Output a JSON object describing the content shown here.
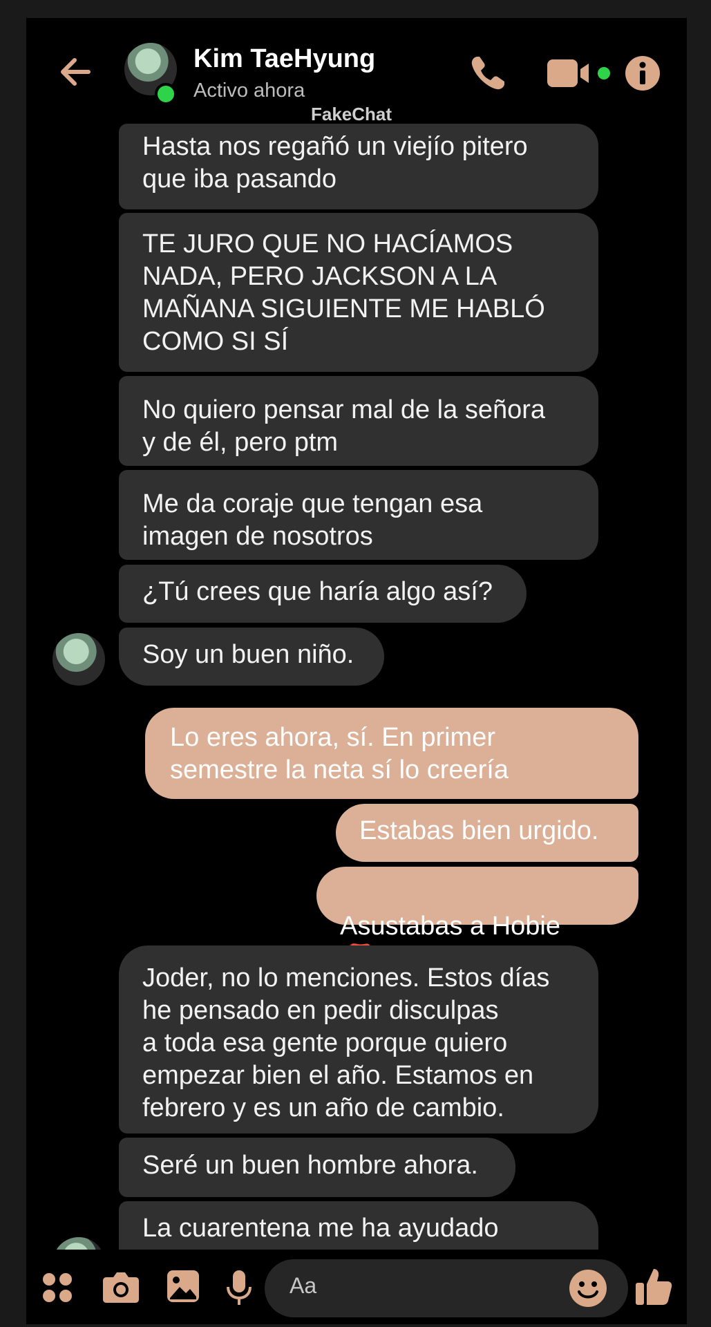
{
  "header": {
    "contact_name": "Kim TaeHyung",
    "status": "Activo ahora",
    "watermark": "FakeChat",
    "accent_color": "#d9a98a"
  },
  "messages": [
    {
      "from": "contact",
      "text": "Hasta nos regañó un viejío pitero\nque iba pasando"
    },
    {
      "from": "contact",
      "text": "TE JURO QUE NO HACÍAMOS\nNADA, PERO JACKSON A LA\nMAÑANA SIGUIENTE ME HABLÓ\nCOMO SI SÍ"
    },
    {
      "from": "contact",
      "text": "No quiero pensar mal de la señora\ny de él, pero ptm"
    },
    {
      "from": "contact",
      "text": "Me da coraje que tengan esa\nimagen de nosotros"
    },
    {
      "from": "contact",
      "text": "¿Tú crees que haría algo así?"
    },
    {
      "from": "contact",
      "text": "Soy un buen niño."
    },
    {
      "from": "me",
      "text": "Lo eres ahora, sí. En primer\nsemestre la neta sí lo creería"
    },
    {
      "from": "me",
      "text": "Estabas bien urgido."
    },
    {
      "from": "me",
      "text": "Asustabas a Hobie"
    },
    {
      "from": "contact",
      "text": "Joder, no lo menciones. Estos días\nhe pensado en pedir disculpas\na toda esa gente porque quiero\nempezar bien el año. Estamos en\nfebrero y es un año de cambio."
    },
    {
      "from": "contact",
      "text": "Seré un buen hombre ahora."
    },
    {
      "from": "contact",
      "text": "La cuarentena me ha ayudado"
    }
  ],
  "emoji": "👺",
  "composer": {
    "placeholder": "Aa"
  }
}
